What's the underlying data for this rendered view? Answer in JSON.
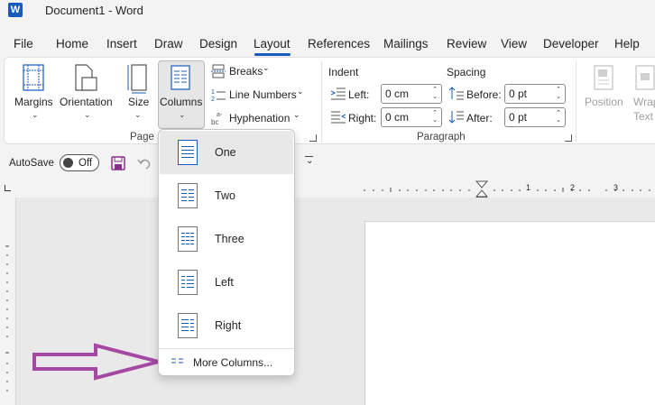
{
  "app": {
    "title": "Document1  -  Word",
    "logo": "W"
  },
  "tabs": [
    "File",
    "Home",
    "Insert",
    "Draw",
    "Design",
    "Layout",
    "References",
    "Mailings",
    "Review",
    "View",
    "Developer",
    "Help"
  ],
  "active_tab": "Layout",
  "ribbon": {
    "page_setup": {
      "margins": "Margins",
      "orientation": "Orientation",
      "size": "Size",
      "columns": "Columns",
      "breaks": "Breaks",
      "line_numbers": "Line Numbers",
      "hyphenation": "Hyphenation",
      "group_label": "Page S"
    },
    "paragraph": {
      "indent_label": "Indent",
      "spacing_label": "Spacing",
      "left_label": "Left:",
      "right_label": "Right:",
      "before_label": "Before:",
      "after_label": "After:",
      "left_value": "0 cm",
      "right_value": "0 cm",
      "before_value": "0 pt",
      "after_value": "0 pt",
      "group_label": "Paragraph"
    },
    "arrange": {
      "position": "Position",
      "wrap": "Wrap",
      "text": "Text"
    }
  },
  "qat": {
    "autosave": "AutoSave",
    "toggle": "Off"
  },
  "ruler": {
    "marks": [
      "1",
      "2",
      "3"
    ]
  },
  "columns_menu": {
    "options": [
      "One",
      "Two",
      "Three",
      "Left",
      "Right"
    ],
    "selected": "One",
    "more": "More Columns..."
  },
  "colors": {
    "accent": "#185abd",
    "arrow": "#a349a4"
  }
}
